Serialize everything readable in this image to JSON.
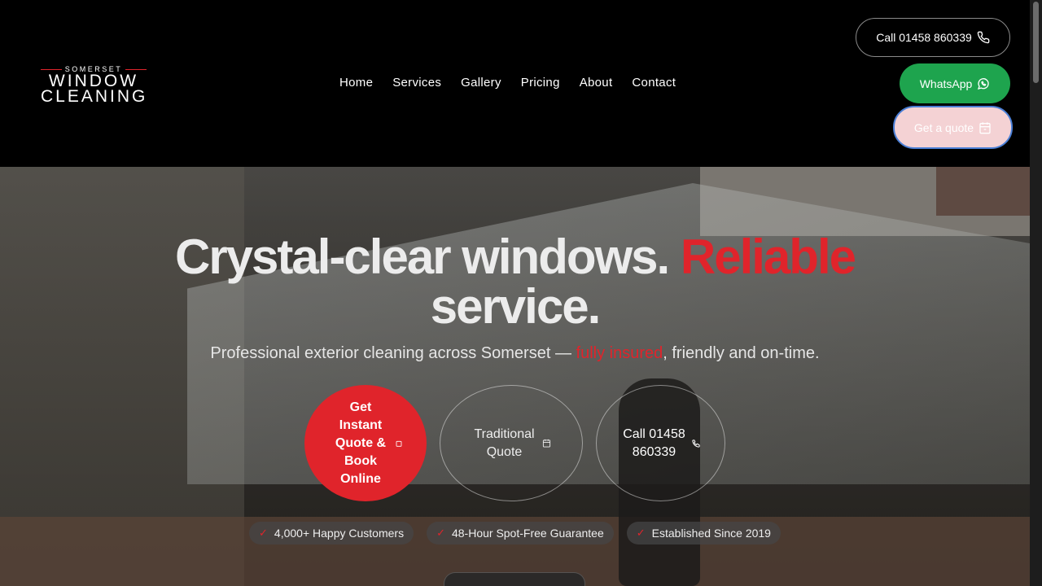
{
  "brand": {
    "top": "SOMERSET",
    "line1": "WINDOW",
    "line2": "CLEANING",
    "accent_color": "#e0242b"
  },
  "nav": {
    "items": [
      "Home",
      "Services",
      "Gallery",
      "Pricing",
      "About",
      "Contact"
    ]
  },
  "header_buttons": {
    "call": {
      "label": "Call 01458 860339",
      "icon": "phone-icon"
    },
    "whatsapp": {
      "label": "WhatsApp",
      "icon": "whatsapp-icon",
      "color": "#1ea44e"
    },
    "quote": {
      "label": "Get a quote",
      "icon": "calendar-icon"
    }
  },
  "hero": {
    "headline_part1": "Crystal-clear windows. ",
    "headline_accent": "Reliable",
    "headline_part2": "service.",
    "sub_part1": "Professional exterior cleaning across Somerset — ",
    "sub_accent": "fully insured",
    "sub_part2": ", friendly and on-time.",
    "cta_primary": "Get Instant Quote & Book Online",
    "cta_traditional": "Traditional Quote",
    "cta_call": "Call 01458 860339"
  },
  "badges": [
    "4,000+ Happy Customers",
    "48-Hour Spot-Free Guarantee",
    "Established Since 2019"
  ]
}
